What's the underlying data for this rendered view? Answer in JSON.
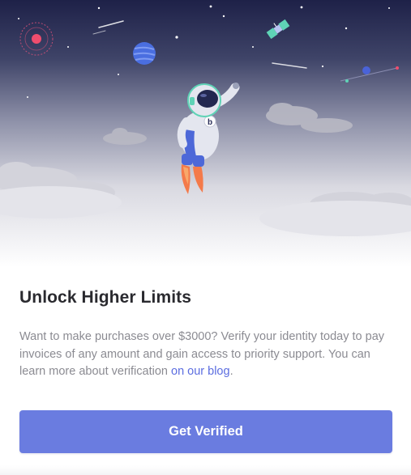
{
  "modal": {
    "title": "Unlock Higher Limits",
    "description_text": "Want to make purchases over $3000? Verify your identity today to pay invoices of any amount and gain access to priority support. You can learn more about verification ",
    "blog_link_label": "on our blog",
    "description_end": ".",
    "cta_label": "Get Verified"
  },
  "illustration": {
    "astronaut_badge": "b",
    "icons": [
      "astronaut-icon",
      "planet-icon",
      "satellite-icon",
      "ringed-planet-icon",
      "cloud-icon",
      "shooting-star-icon"
    ]
  },
  "colors": {
    "sky_top": "#1e2148",
    "accent": "#6a7ce0",
    "link": "#5b6de0",
    "title": "#2a2a2f",
    "body_text": "#8b8b92"
  }
}
